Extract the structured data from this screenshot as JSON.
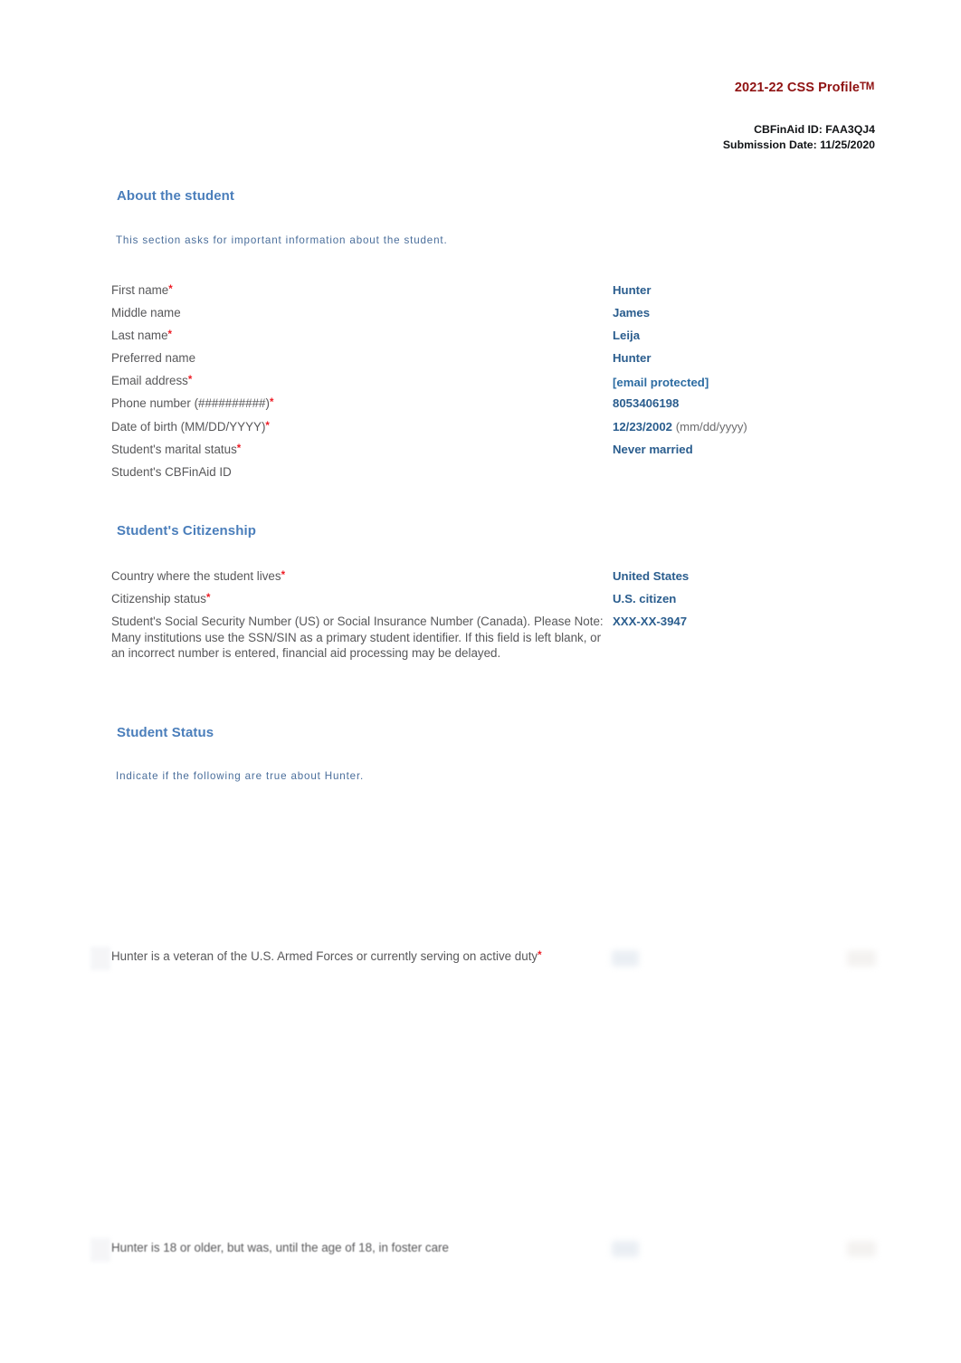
{
  "header": {
    "doc_title": "2021-22 CSS Profile",
    "doc_title_tm": "TM",
    "cbfinaid_id": "CBFinAid ID: FAA3QJ4",
    "submission_date": "Submission Date: 11/25/2020"
  },
  "sections": [
    {
      "title": "About the student",
      "description": "This section asks for important information about the student.",
      "fields": [
        {
          "label": "First name",
          "required": true,
          "value": "Hunter"
        },
        {
          "label": "Middle name",
          "required": false,
          "value": "James"
        },
        {
          "label": "Last name",
          "required": true,
          "value": "Leija"
        },
        {
          "label": "Preferred name",
          "required": false,
          "value": "Hunter"
        },
        {
          "label": "Email address",
          "required": true,
          "value": "[email protected]",
          "link": true
        },
        {
          "label": "Phone number (##########)",
          "required": true,
          "value": "8053406198"
        },
        {
          "label": "Date of birth (MM/DD/YYYY)",
          "required": true,
          "value": "12/23/2002",
          "suffix": "(mm/dd/yyyy)"
        },
        {
          "label": "Student's marital status",
          "required": true,
          "value": "Never married"
        },
        {
          "label": "Student's CBFinAid ID",
          "required": false,
          "value": ""
        }
      ]
    },
    {
      "title": "Student's Citizenship",
      "description": "",
      "fields": [
        {
          "label": "Country where the student lives",
          "required": true,
          "value": "United States"
        },
        {
          "label": "Citizenship status",
          "required": true,
          "value": "U.S. citizen"
        },
        {
          "label": "Student's Social Security Number (US) or Social Insurance Number (Canada). Please Note: Many institutions use the SSN/SIN as a primary student identifier. If this field is left blank, or an incorrect number is entered, financial aid processing may be delayed.",
          "required": false,
          "value": "XXX-XX-3947"
        }
      ]
    },
    {
      "title": "Student Status",
      "description": "Indicate if the following are true about Hunter."
    }
  ],
  "status_questions": [
    {
      "label": "Hunter is a veteran of the U.S. Armed Forces or currently serving on active duty",
      "required": true,
      "value": ""
    },
    {
      "label": "Hunter is 18 or older, but was, until the age of 18, in foster care",
      "required": false,
      "value": ""
    }
  ],
  "colors": {
    "title_red": "#8f1212",
    "section_blue": "#4a7ebb",
    "value_blue": "#2a5d8e",
    "label_gray": "#58585a",
    "required_red": "#ee1c25"
  }
}
